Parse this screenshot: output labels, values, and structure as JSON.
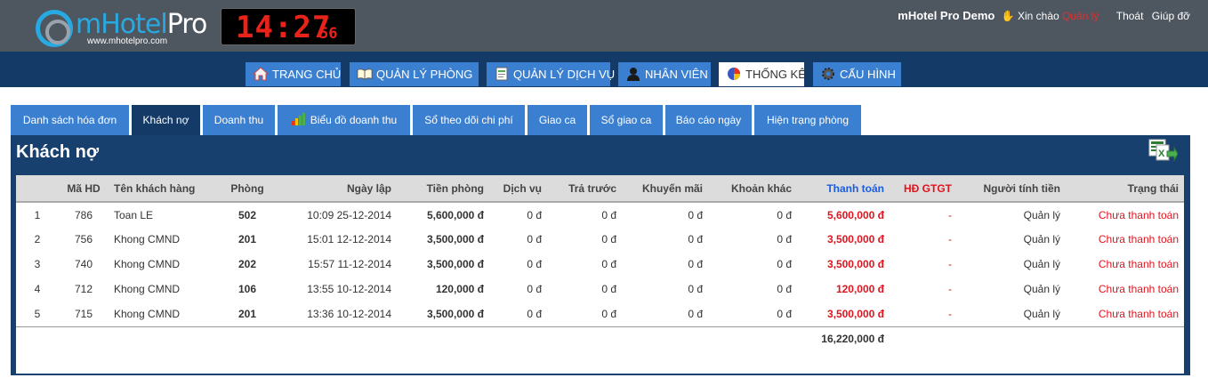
{
  "header": {
    "logo_main": "mHotel",
    "logo_pro": "Pro",
    "logo_url": "www.mhotelpro.com",
    "clock_time": "14:27",
    "clock_seconds": "56",
    "brand": "mHotel Pro Demo",
    "hand_icon": "hand-icon",
    "greeting": "Xin chào",
    "username": "Quản lý",
    "logout": "Thoát",
    "help": "Giúp đỡ"
  },
  "mainnav": [
    {
      "label": "TRANG CHỦ",
      "icon": "home-icon"
    },
    {
      "label": "QUẢN LÝ PHÒNG",
      "icon": "book-icon"
    },
    {
      "label": "QUẢN LÝ DỊCH VỤ",
      "icon": "document-icon"
    },
    {
      "label": "NHÂN VIÊN",
      "icon": "user-icon"
    },
    {
      "label": "THỐNG KÊ",
      "icon": "pie-chart-icon",
      "active": true
    },
    {
      "label": "CẤU HÌNH",
      "icon": "gear-icon"
    }
  ],
  "subtabs": [
    {
      "label": "Danh sách hóa đơn"
    },
    {
      "label": "Khách nợ",
      "active": true
    },
    {
      "label": "Doanh thu"
    },
    {
      "label": "Biểu đồ doanh thu",
      "icon": "bar-chart-icon"
    },
    {
      "label": "Sổ theo dõi chi phí"
    },
    {
      "label": "Giao ca"
    },
    {
      "label": "Sổ giao ca"
    },
    {
      "label": "Báo cáo ngày"
    },
    {
      "label": "Hiện trạng phòng"
    }
  ],
  "panel": {
    "title": "Khách nợ",
    "export_icon": "excel-export-icon"
  },
  "table": {
    "columns": [
      "",
      "Mã HD",
      "Tên khách hàng",
      "Phòng",
      "Ngày lập",
      "Tiền phòng",
      "Dịch vụ",
      "Trả trước",
      "Khuyến mãi",
      "Khoản khác",
      "Thanh toán",
      "HĐ GTGT",
      "Người tính tiền",
      "Trạng thái"
    ],
    "rows": [
      {
        "no": "1",
        "ma_hd": "786",
        "ten": "Toan LE",
        "phong": "502",
        "ngay": "10:09 25-12-2014",
        "tien_phong": "5,600,000 đ",
        "dich_vu": "0 đ",
        "tra_truoc": "0 đ",
        "khuyen_mai": "0 đ",
        "khoan_khac": "0 đ",
        "thanh_toan": "5,600,000 đ",
        "gtgt": "-",
        "nguoi_tinh": "Quản lý",
        "trang_thai": "Chưa thanh toán"
      },
      {
        "no": "2",
        "ma_hd": "756",
        "ten": "Khong CMND",
        "phong": "201",
        "ngay": "15:01 12-12-2014",
        "tien_phong": "3,500,000 đ",
        "dich_vu": "0 đ",
        "tra_truoc": "0 đ",
        "khuyen_mai": "0 đ",
        "khoan_khac": "0 đ",
        "thanh_toan": "3,500,000 đ",
        "gtgt": "-",
        "nguoi_tinh": "Quản lý",
        "trang_thai": "Chưa thanh toán"
      },
      {
        "no": "3",
        "ma_hd": "740",
        "ten": "Khong CMND",
        "phong": "202",
        "ngay": "15:57 11-12-2014",
        "tien_phong": "3,500,000 đ",
        "dich_vu": "0 đ",
        "tra_truoc": "0 đ",
        "khuyen_mai": "0 đ",
        "khoan_khac": "0 đ",
        "thanh_toan": "3,500,000 đ",
        "gtgt": "-",
        "nguoi_tinh": "Quản lý",
        "trang_thai": "Chưa thanh toán"
      },
      {
        "no": "4",
        "ma_hd": "712",
        "ten": "Khong CMND",
        "phong": "106",
        "ngay": "13:55 10-12-2014",
        "tien_phong": "120,000 đ",
        "dich_vu": "0 đ",
        "tra_truoc": "0 đ",
        "khuyen_mai": "0 đ",
        "khoan_khac": "0 đ",
        "thanh_toan": "120,000 đ",
        "gtgt": "-",
        "nguoi_tinh": "Quản lý",
        "trang_thai": "Chưa thanh toán"
      },
      {
        "no": "5",
        "ma_hd": "715",
        "ten": "Khong CMND",
        "phong": "201",
        "ngay": "13:36 10-12-2014",
        "tien_phong": "3,500,000 đ",
        "dich_vu": "0 đ",
        "tra_truoc": "0 đ",
        "khuyen_mai": "0 đ",
        "khoan_khac": "0 đ",
        "thanh_toan": "3,500,000 đ",
        "gtgt": "-",
        "nguoi_tinh": "Quản lý",
        "trang_thai": "Chưa thanh toán"
      }
    ],
    "total": "16,220,000 đ"
  },
  "colors": {
    "topbar": "#4e5660",
    "nav_bg": "#143a67",
    "tab_blue": "#3b7fd1",
    "accent_red": "#e0141e",
    "accent_blue": "#1a5de0"
  }
}
